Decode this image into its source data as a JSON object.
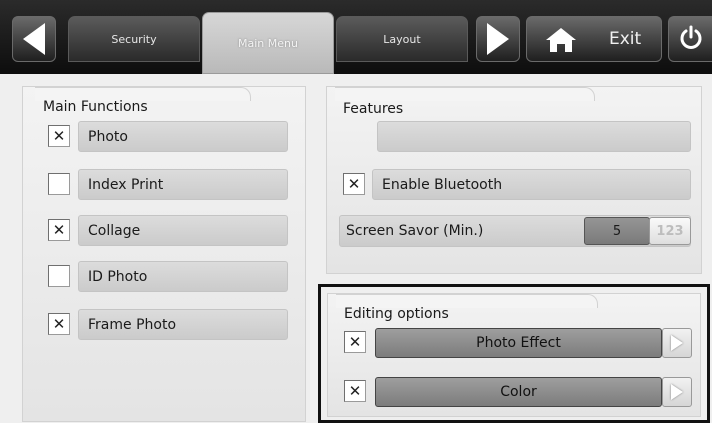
{
  "tabs": [
    {
      "label": "Security",
      "active": false
    },
    {
      "label": "Main Menu",
      "active": true
    },
    {
      "label": "Layout",
      "active": false
    }
  ],
  "toolbar": {
    "back_icon": "arrow-left-icon",
    "forward_icon": "arrow-right-icon",
    "home_icon": "home-icon",
    "exit_label": "Exit",
    "power_icon": "power-icon"
  },
  "main_functions": {
    "title": "Main Functions",
    "items": [
      {
        "label": "Photo",
        "checked": true
      },
      {
        "label": "Index Print",
        "checked": false
      },
      {
        "label": "Collage",
        "checked": true
      },
      {
        "label": "ID Photo",
        "checked": false
      },
      {
        "label": "Frame Photo",
        "checked": true
      }
    ]
  },
  "features": {
    "title": "Features",
    "empty_field": "",
    "bluetooth": {
      "label": "Enable Bluetooth",
      "checked": true
    },
    "screen_saver": {
      "label": "Screen Savor (Min.)",
      "value": "5",
      "keypad_label": "123"
    }
  },
  "editing_options": {
    "title": "Editing options",
    "items": [
      {
        "label": "Photo Effect",
        "checked": true
      },
      {
        "label": "Color",
        "checked": true
      }
    ]
  },
  "check_mark": "✕",
  "colors": {
    "topbar": "#111111",
    "active_tab": "#c8c8c8",
    "panel_bg": "#ececec",
    "field_bg": "#d3d3d3",
    "dropdown_bg": "#8e8e8e"
  }
}
